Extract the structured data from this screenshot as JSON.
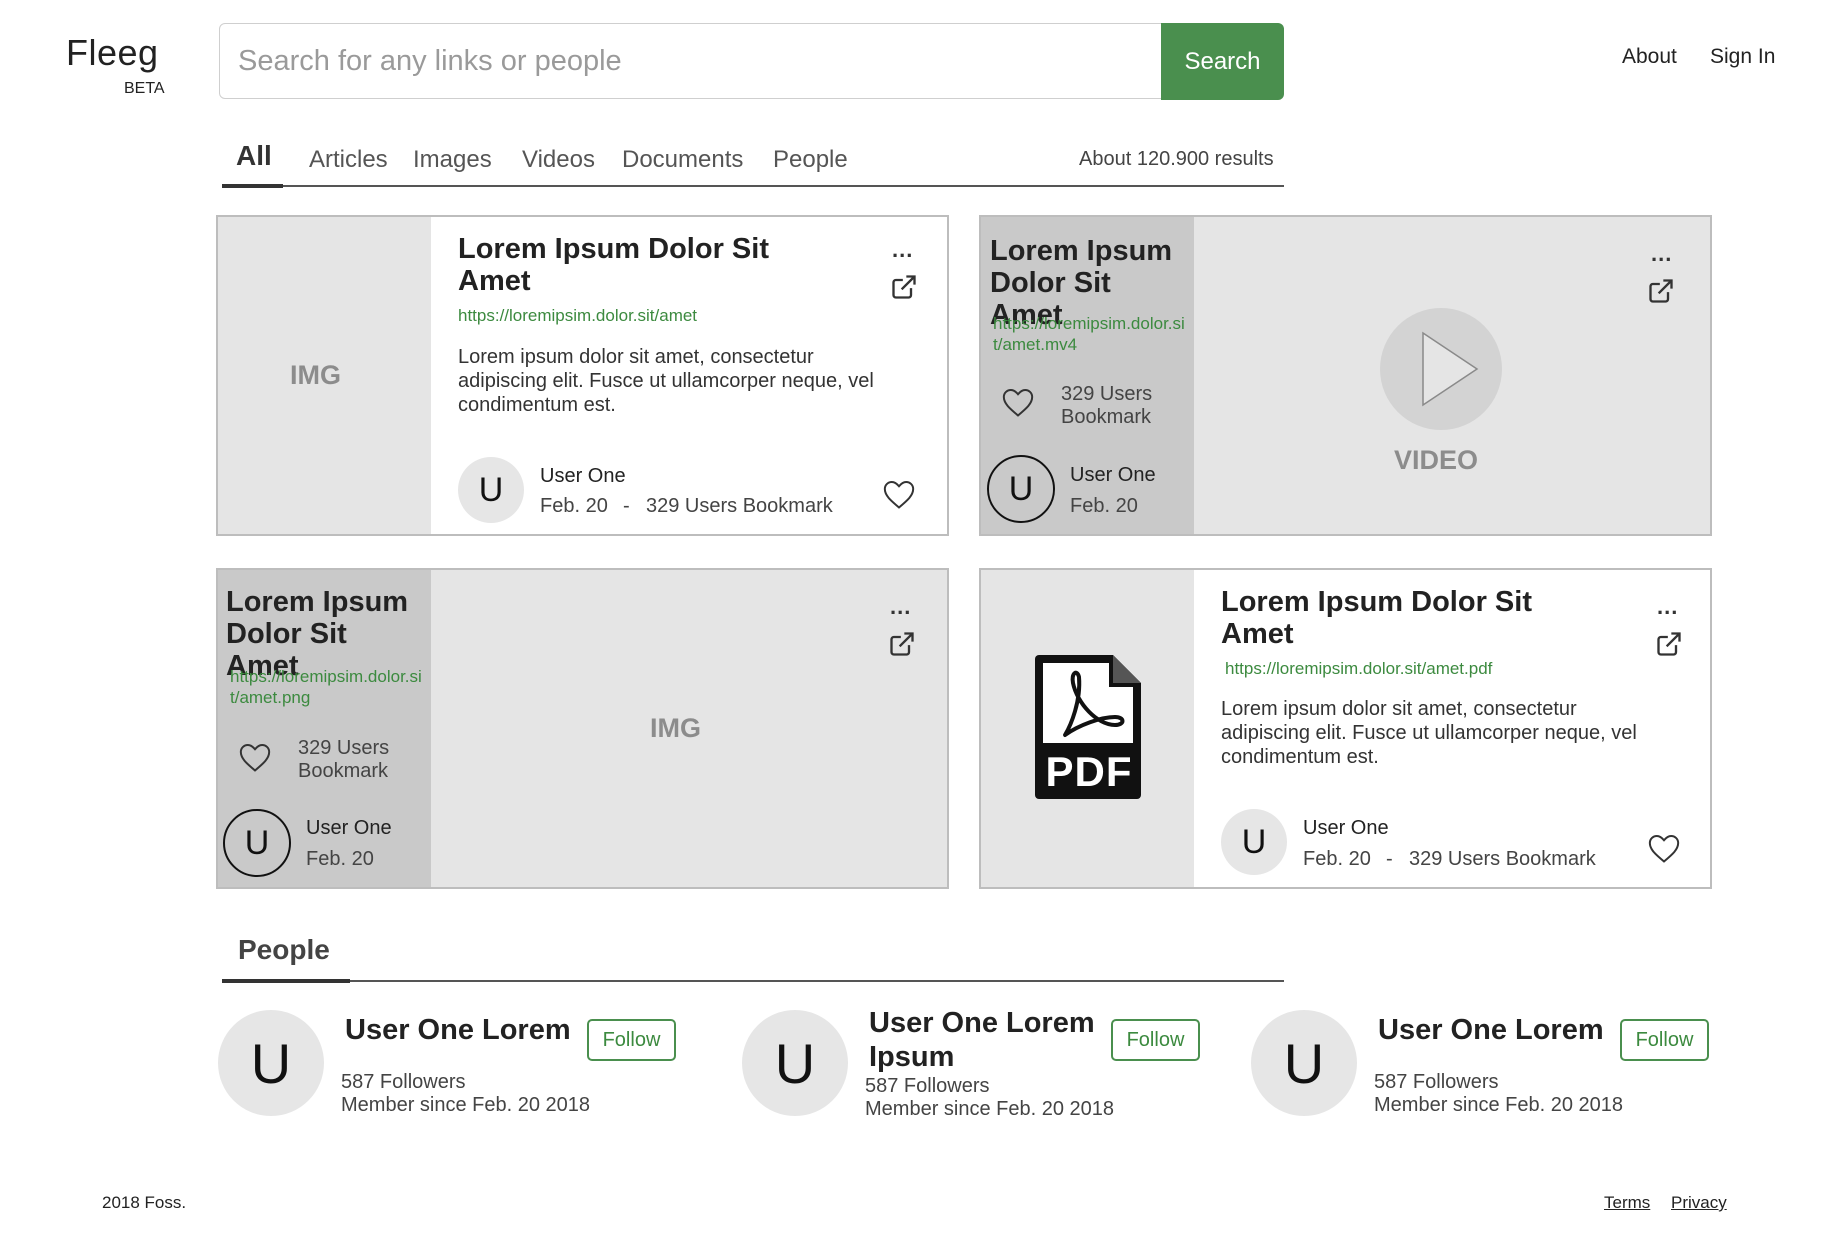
{
  "brand": {
    "name": "Fleeg",
    "badge": "BETA"
  },
  "search": {
    "placeholder": "Search for any links or people",
    "button_label": "Search"
  },
  "nav": {
    "about": "About",
    "sign_in": "Sign In"
  },
  "tabs": {
    "items": [
      "All",
      "Articles",
      "Images",
      "Videos",
      "Documents",
      "People"
    ],
    "active": "All",
    "results_count": "About 120.900 results"
  },
  "cards": [
    {
      "type": "article",
      "title": "Lorem Ipsum Dolor Sit Amet",
      "url": "https://loremipsim.dolor.sit/amet",
      "description": "Lorem ipsum dolor sit amet, consectetur adipiscing elit. Fusce ut ullamcorper neque, vel condimentum est.",
      "thumbnail_label": "IMG",
      "user": {
        "initial": "U",
        "name": "User One",
        "date": "Feb. 20",
        "separator": "-",
        "bookmarks": "329 Users Bookmark"
      },
      "menu": "..."
    },
    {
      "type": "video",
      "title": "Lorem Ipsum Dolor Sit Amet",
      "url": "https://loremipsim.dolor.sit/amet.mv4",
      "bookmarks": "329 Users Bookmark",
      "media_label": "VIDEO",
      "user": {
        "initial": "U",
        "name": "User One",
        "date": "Feb. 20"
      },
      "menu": "..."
    },
    {
      "type": "image",
      "title": "Lorem Ipsum Dolor Sit Amet",
      "url": "https://loremipsim.dolor.sit/amet.png",
      "bookmarks": "329 Users Bookmark",
      "media_label": "IMG",
      "user": {
        "initial": "U",
        "name": "User One",
        "date": "Feb. 20"
      },
      "menu": "..."
    },
    {
      "type": "document",
      "title": "Lorem Ipsum Dolor Sit Amet",
      "url": "https://loremipsim.dolor.sit/amet.pdf",
      "description": "Lorem ipsum dolor sit amet, consectetur adipiscing elit. Fusce ut ullamcorper neque, vel condimentum est.",
      "icon_label": "PDF",
      "user": {
        "initial": "U",
        "name": "User One",
        "date": "Feb. 20",
        "separator": "-",
        "bookmarks": "329 Users Bookmark"
      },
      "menu": "..."
    }
  ],
  "people": {
    "heading": "People",
    "items": [
      {
        "initial": "U",
        "name": "User One Lorem",
        "followers": "587 Followers",
        "member_since": "Member since Feb. 20  2018",
        "follow_label": "Follow"
      },
      {
        "initial": "U",
        "name": "User One Lorem Ipsum",
        "followers": "587 Followers",
        "member_since": "Member since Feb. 20  2018",
        "follow_label": "Follow"
      },
      {
        "initial": "U",
        "name": "User One Lorem",
        "followers": "587 Followers",
        "member_since": "Member since Feb. 20  2018",
        "follow_label": "Follow"
      }
    ]
  },
  "footer": {
    "copyright": "2018 Foss.",
    "terms": "Terms",
    "privacy": "Privacy"
  },
  "colors": {
    "accent": "#4a8f4e",
    "url_green": "#3c8a3f",
    "panel_light": "#e5e5e5",
    "panel_dark": "#c9c9c9"
  }
}
